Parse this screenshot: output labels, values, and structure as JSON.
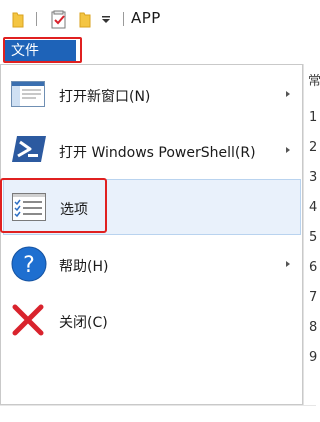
{
  "window": {
    "title": "APP"
  },
  "quick_access": {
    "icons": [
      "folder-icon",
      "properties-icon",
      "folder-icon",
      "customize-dropdown-icon"
    ]
  },
  "ribbon": {
    "file_tab_label": "文件"
  },
  "file_menu": {
    "items": [
      {
        "label": "打开新窗口(N)",
        "icon": "new-window-icon",
        "submenu": true
      },
      {
        "label": "打开 Windows PowerShell(R)",
        "icon": "powershell-icon",
        "submenu": true
      },
      {
        "label": "选项",
        "icon": "options-icon",
        "submenu": false,
        "highlighted": true
      },
      {
        "label": "帮助(H)",
        "icon": "help-icon",
        "submenu": true
      },
      {
        "label": "关闭(C)",
        "icon": "close-icon",
        "submenu": false
      }
    ]
  },
  "content_pane": {
    "header_char": "常",
    "row_digits": [
      "1",
      "2",
      "3",
      "4",
      "5",
      "6",
      "7",
      "8",
      "9"
    ]
  },
  "colors": {
    "file_tab_bg": "#1e63b8",
    "highlight_border": "#e02020",
    "selected_item_bg": "#e9f1fb",
    "help_icon_bg": "#1e6fd0",
    "close_x": "#d9232d",
    "powershell_bg": "#2c5aa0"
  }
}
